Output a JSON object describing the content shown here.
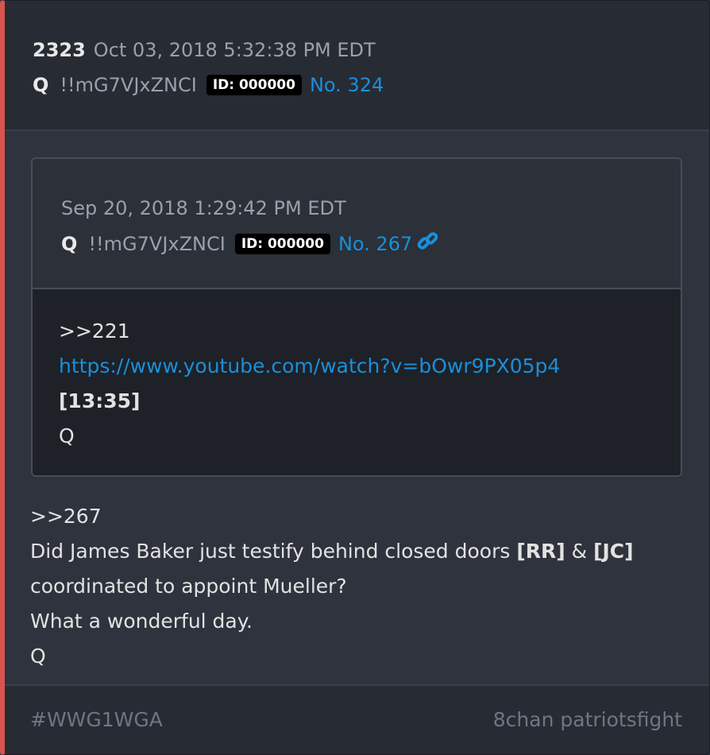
{
  "post": {
    "count": "2323",
    "date": "Oct 03, 2018 5:32:38 PM EDT",
    "name": "Q",
    "tripcode": "!!mG7VJxZNCI",
    "id_badge": "ID: 000000",
    "post_number": "No. 324"
  },
  "quoted_post": {
    "date": "Sep 20, 2018 1:29:42 PM EDT",
    "name": "Q",
    "tripcode": "!!mG7VJxZNCI",
    "id_badge": "ID: 000000",
    "post_number": "No. 267",
    "link_icon": "link-icon",
    "body": {
      "reply_ref": ">>221",
      "url": "https://www.youtube.com/watch?v=bOwr9PX05p4",
      "timestamp": "[13:35]",
      "signature": "Q"
    }
  },
  "body": {
    "reply_ref": ">>267",
    "line1_prefix": "Did James Baker just testify behind closed doors ",
    "rr": "[RR]",
    "amp": " & ",
    "jc": "[JC]",
    "line2": "coordinated to appoint Mueller?",
    "line3": "What a wonderful day.",
    "signature": "Q"
  },
  "footer": {
    "hashtag": "#WWG1WGA",
    "source": "8chan patriotsfight"
  },
  "colors": {
    "accent_border": "#d9534f",
    "link": "#1a8fd9",
    "background": "#2e333d"
  }
}
